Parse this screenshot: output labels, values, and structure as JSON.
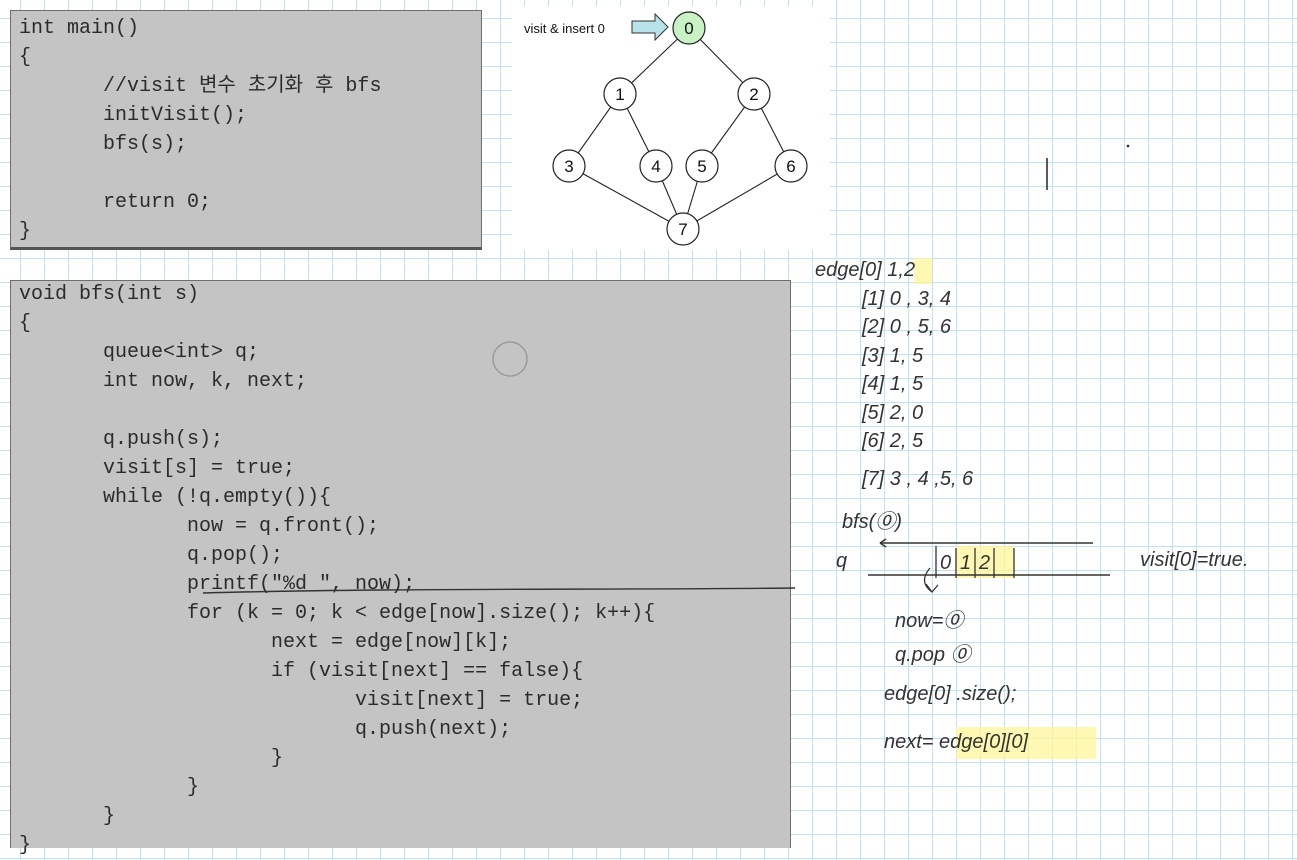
{
  "main_code": [
    "int main()",
    "{",
    "       //visit 변수 초기화 후 bfs",
    "       initVisit();",
    "       bfs(s);",
    "",
    "       return 0;",
    "}"
  ],
  "bfs_code": [
    "void bfs(int s)",
    "{",
    "       queue<int> q;",
    "       int now, k, next;",
    "",
    "       q.push(s);",
    "       visit[s] = true;",
    "       while (!q.empty()){",
    "              now = q.front();",
    "              q.pop();",
    "              printf(\"%d \", now);",
    "              for (k = 0; k < edge[now].size(); k++){",
    "                     next = edge[now][k];",
    "                     if (visit[next] == false){",
    "                            visit[next] = true;",
    "                            q.push(next);",
    "                     }",
    "              }",
    "       }",
    "}"
  ],
  "graph": {
    "caption": "visit & insert 0",
    "nodes": [
      "0",
      "1",
      "2",
      "3",
      "4",
      "5",
      "6",
      "7"
    ],
    "visited_color": "#c8f2c4"
  },
  "notes": {
    "edge_list": [
      "edge[0] 1,2",
      "[1] 0 , 3, 4",
      "[2] 0 , 5, 6",
      "[3] 1, 5",
      "[4] 1, 5",
      "[5] 2, 0",
      "[6] 2, 5",
      "[7] 3 , 4 ,5, 6"
    ],
    "bfs_call": "bfs(⓪)",
    "queue_label": "q",
    "queue_cells": [
      "0",
      "1",
      "2"
    ],
    "visit_note": "visit[0]=true.",
    "now_line": "now=⓪",
    "pop_line": "q.pop ⓪",
    "size_line": "edge[0] .size();",
    "next_line": "next= edge[0][0]"
  }
}
